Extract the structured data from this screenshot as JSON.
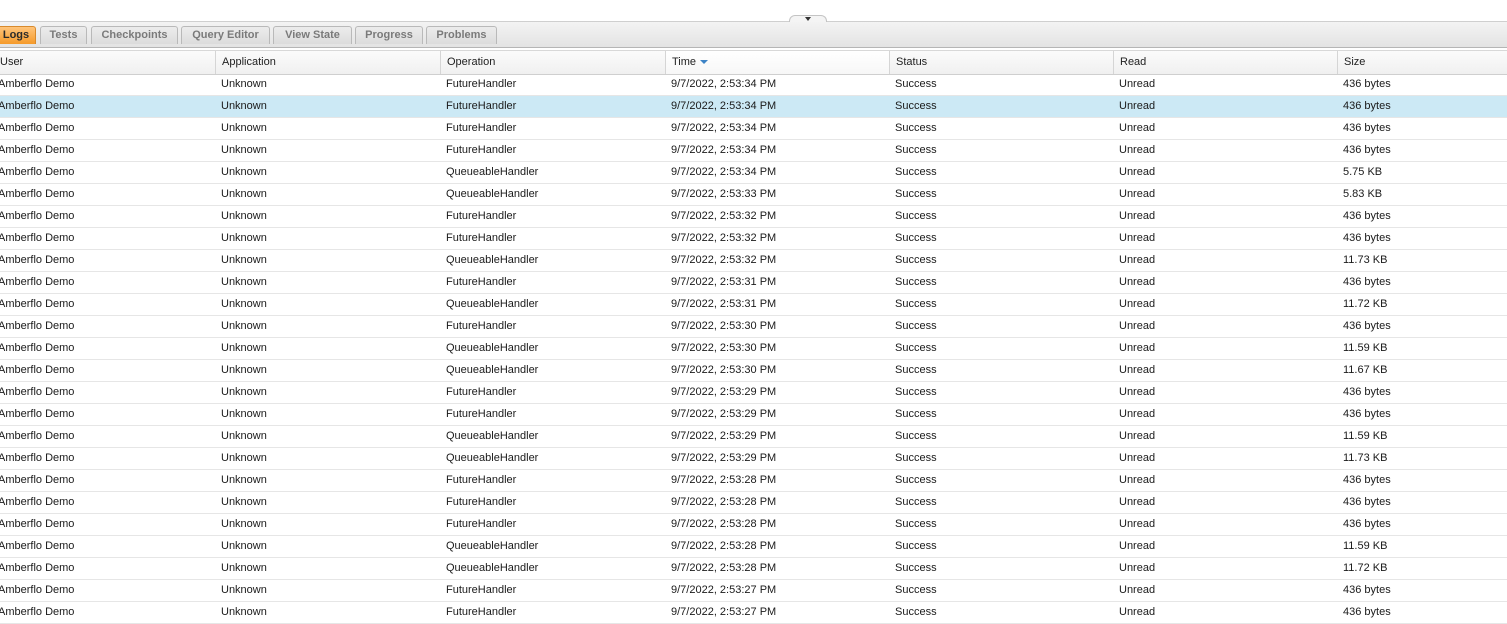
{
  "tabs": [
    "Logs",
    "Tests",
    "Checkpoints",
    "Query Editor",
    "View State",
    "Progress",
    "Problems"
  ],
  "active_tab": "Logs",
  "columns": [
    "User",
    "Application",
    "Operation",
    "Time",
    "Status",
    "Read",
    "Size"
  ],
  "sorted_column": "Time",
  "sort_direction": "descending",
  "selected_row": 1,
  "rows": [
    [
      "Amberflo Demo",
      "Unknown",
      "FutureHandler",
      "9/7/2022, 2:53:34 PM",
      "Success",
      "Unread",
      "436 bytes"
    ],
    [
      "Amberflo Demo",
      "Unknown",
      "FutureHandler",
      "9/7/2022, 2:53:34 PM",
      "Success",
      "Unread",
      "436 bytes"
    ],
    [
      "Amberflo Demo",
      "Unknown",
      "FutureHandler",
      "9/7/2022, 2:53:34 PM",
      "Success",
      "Unread",
      "436 bytes"
    ],
    [
      "Amberflo Demo",
      "Unknown",
      "FutureHandler",
      "9/7/2022, 2:53:34 PM",
      "Success",
      "Unread",
      "436 bytes"
    ],
    [
      "Amberflo Demo",
      "Unknown",
      "QueueableHandler",
      "9/7/2022, 2:53:34 PM",
      "Success",
      "Unread",
      "5.75 KB"
    ],
    [
      "Amberflo Demo",
      "Unknown",
      "QueueableHandler",
      "9/7/2022, 2:53:33 PM",
      "Success",
      "Unread",
      "5.83 KB"
    ],
    [
      "Amberflo Demo",
      "Unknown",
      "FutureHandler",
      "9/7/2022, 2:53:32 PM",
      "Success",
      "Unread",
      "436 bytes"
    ],
    [
      "Amberflo Demo",
      "Unknown",
      "FutureHandler",
      "9/7/2022, 2:53:32 PM",
      "Success",
      "Unread",
      "436 bytes"
    ],
    [
      "Amberflo Demo",
      "Unknown",
      "QueueableHandler",
      "9/7/2022, 2:53:32 PM",
      "Success",
      "Unread",
      "11.73 KB"
    ],
    [
      "Amberflo Demo",
      "Unknown",
      "FutureHandler",
      "9/7/2022, 2:53:31 PM",
      "Success",
      "Unread",
      "436 bytes"
    ],
    [
      "Amberflo Demo",
      "Unknown",
      "QueueableHandler",
      "9/7/2022, 2:53:31 PM",
      "Success",
      "Unread",
      "11.72 KB"
    ],
    [
      "Amberflo Demo",
      "Unknown",
      "FutureHandler",
      "9/7/2022, 2:53:30 PM",
      "Success",
      "Unread",
      "436 bytes"
    ],
    [
      "Amberflo Demo",
      "Unknown",
      "QueueableHandler",
      "9/7/2022, 2:53:30 PM",
      "Success",
      "Unread",
      "11.59 KB"
    ],
    [
      "Amberflo Demo",
      "Unknown",
      "QueueableHandler",
      "9/7/2022, 2:53:30 PM",
      "Success",
      "Unread",
      "11.67 KB"
    ],
    [
      "Amberflo Demo",
      "Unknown",
      "FutureHandler",
      "9/7/2022, 2:53:29 PM",
      "Success",
      "Unread",
      "436 bytes"
    ],
    [
      "Amberflo Demo",
      "Unknown",
      "FutureHandler",
      "9/7/2022, 2:53:29 PM",
      "Success",
      "Unread",
      "436 bytes"
    ],
    [
      "Amberflo Demo",
      "Unknown",
      "QueueableHandler",
      "9/7/2022, 2:53:29 PM",
      "Success",
      "Unread",
      "11.59 KB"
    ],
    [
      "Amberflo Demo",
      "Unknown",
      "QueueableHandler",
      "9/7/2022, 2:53:29 PM",
      "Success",
      "Unread",
      "11.73 KB"
    ],
    [
      "Amberflo Demo",
      "Unknown",
      "FutureHandler",
      "9/7/2022, 2:53:28 PM",
      "Success",
      "Unread",
      "436 bytes"
    ],
    [
      "Amberflo Demo",
      "Unknown",
      "FutureHandler",
      "9/7/2022, 2:53:28 PM",
      "Success",
      "Unread",
      "436 bytes"
    ],
    [
      "Amberflo Demo",
      "Unknown",
      "FutureHandler",
      "9/7/2022, 2:53:28 PM",
      "Success",
      "Unread",
      "436 bytes"
    ],
    [
      "Amberflo Demo",
      "Unknown",
      "QueueableHandler",
      "9/7/2022, 2:53:28 PM",
      "Success",
      "Unread",
      "11.59 KB"
    ],
    [
      "Amberflo Demo",
      "Unknown",
      "QueueableHandler",
      "9/7/2022, 2:53:28 PM",
      "Success",
      "Unread",
      "11.72 KB"
    ],
    [
      "Amberflo Demo",
      "Unknown",
      "FutureHandler",
      "9/7/2022, 2:53:27 PM",
      "Success",
      "Unread",
      "436 bytes"
    ],
    [
      "Amberflo Demo",
      "Unknown",
      "FutureHandler",
      "9/7/2022, 2:53:27 PM",
      "Success",
      "Unread",
      "436 bytes"
    ]
  ],
  "colors": {
    "active_tab": "#f59a2b",
    "selected_row": "#cce9f5",
    "sort_indicator": "#3c83c6"
  },
  "icons": {
    "splitter": "chevron-down-icon",
    "sort": "sort-descending-icon"
  }
}
